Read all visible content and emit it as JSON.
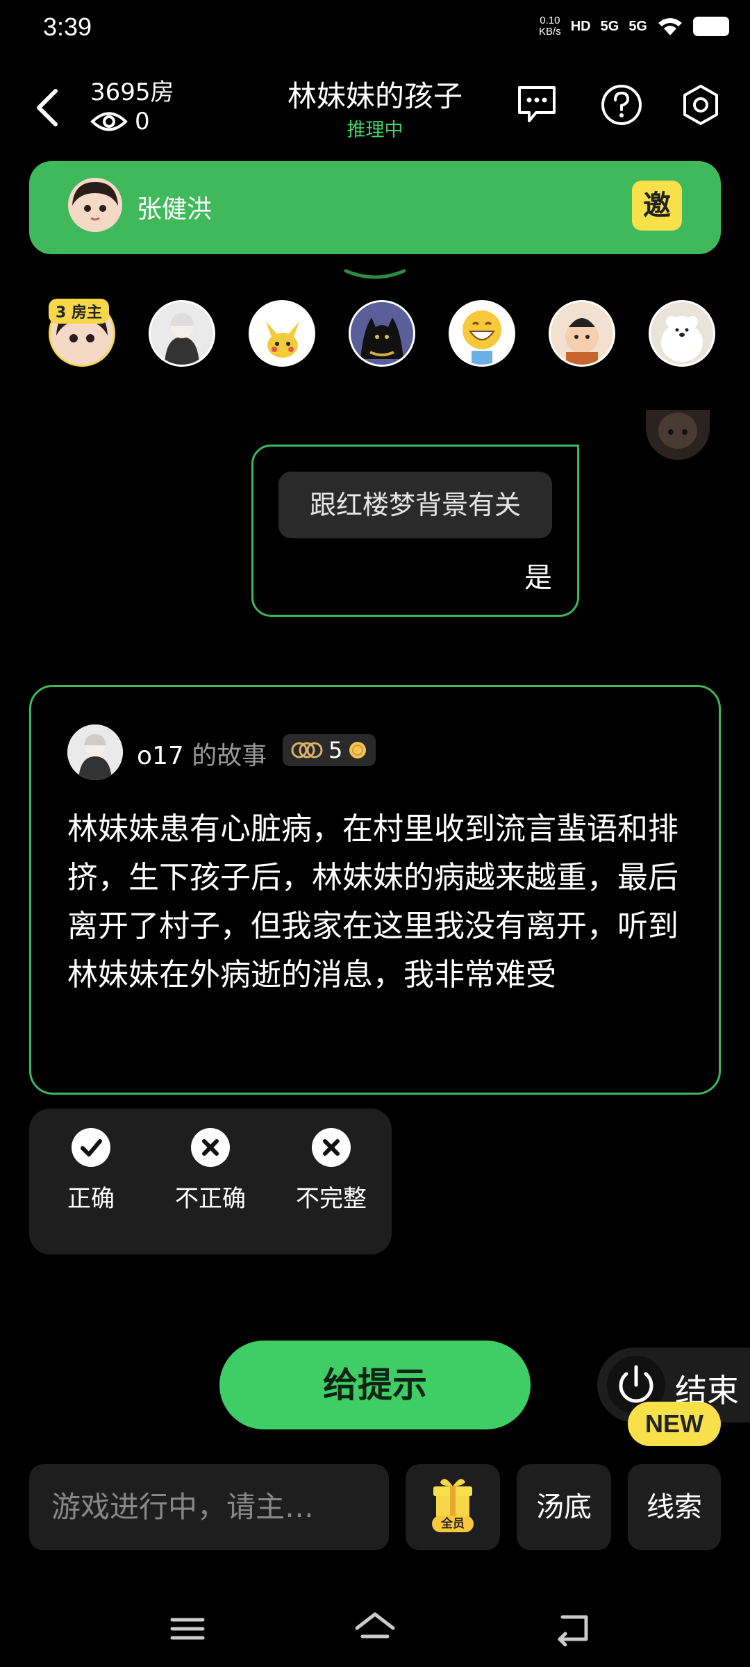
{
  "status_bar": {
    "time": "3:39",
    "net_speed_top": "0.10",
    "net_speed_bottom": "KB/s",
    "hd": "HD",
    "signal_1": "5G",
    "signal_2": "5G"
  },
  "header": {
    "room": "3695房",
    "viewers": "0",
    "title": "林妹妹的孩子",
    "status": "推理中",
    "icons": [
      "back-icon",
      "chat-bubble-icon",
      "help-icon",
      "settings-icon"
    ]
  },
  "host_bar": {
    "name": "张健洪",
    "invite_label": "邀"
  },
  "players": {
    "owner_badge": "3 房主",
    "count": 7
  },
  "question": {
    "text": "跟红楼梦背景有关",
    "answer": "是"
  },
  "story": {
    "user": "o17",
    "label": "的故事",
    "badge_value": "5",
    "text": "林妹妹患有心脏病，在村里收到流言蜚语和排挤，生下孩子后，林妹妹的病越来越重，最后离开了村子，但我家在这里我没有离开，听到林妹妹在外病逝的消息，我非常难受"
  },
  "judge": {
    "correct": "正确",
    "incorrect": "不正确",
    "incomplete": "不完整"
  },
  "controls": {
    "hint": "给提示",
    "end": "结束",
    "new_badge": "NEW"
  },
  "bottom_bar": {
    "input_placeholder": "游戏进行中，请主…",
    "gift_tag": "全员",
    "soup": "汤底",
    "clue": "线索"
  },
  "colors": {
    "accent_green": "#40b95d",
    "button_green": "#3fcd66",
    "badge_yellow": "#f7e04a",
    "background": "#000000",
    "card_bg": "#1e1e1e"
  }
}
